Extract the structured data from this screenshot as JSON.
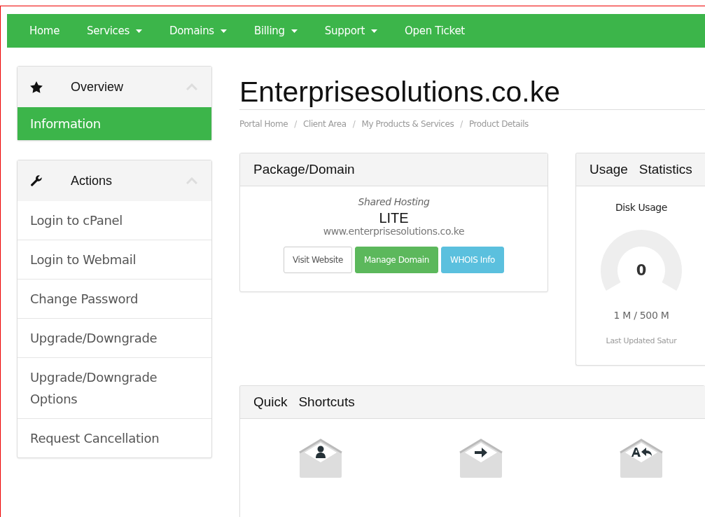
{
  "nav": {
    "items": [
      {
        "label": "Home",
        "dropdown": false
      },
      {
        "label": "Services",
        "dropdown": true
      },
      {
        "label": "Domains",
        "dropdown": true
      },
      {
        "label": "Billing",
        "dropdown": true
      },
      {
        "label": "Support",
        "dropdown": true
      },
      {
        "label": "Open Ticket",
        "dropdown": false
      }
    ]
  },
  "sidebar": {
    "panels": [
      {
        "title": "Overview",
        "items": [
          {
            "label": "Information",
            "selected": true
          }
        ]
      },
      {
        "title": "Actions",
        "items": [
          {
            "label": "Login to cPanel",
            "selected": false
          },
          {
            "label": "Login to Webmail",
            "selected": false
          },
          {
            "label": "Change Password",
            "selected": false
          },
          {
            "label": "Upgrade/Downgrade",
            "selected": false
          },
          {
            "label": "Upgrade/Downgrade Options",
            "selected": false
          },
          {
            "label": "Request Cancellation",
            "selected": false
          }
        ]
      }
    ]
  },
  "page": {
    "title": "Enterprisesolutions.co.ke",
    "breadcrumb": [
      {
        "label": "Portal Home"
      },
      {
        "separator": "/",
        "label": "Client Area"
      },
      {
        "separator": "/",
        "label": "My Products & Services"
      },
      {
        "separator": "/",
        "label": "Product Details"
      }
    ]
  },
  "package": {
    "title": "Package/Domain",
    "group": "Shared Hosting",
    "product": "LITE",
    "domain": "www.enterprisesolutions.co.ke",
    "buttons": [
      {
        "label": "Visit Website",
        "kind": "default"
      },
      {
        "label": "Manage Domain",
        "kind": "success"
      },
      {
        "label": "WHOIS Info",
        "kind": "info"
      }
    ]
  },
  "usage": {
    "title": "Usage   Statistics",
    "label": "Disk Usage",
    "value": "0",
    "reading": "1 M / 500 M",
    "updated": "Last Updated Satur"
  },
  "shortcuts": {
    "title": "Quick   Shortcuts",
    "items": [
      {
        "kind": "person"
      },
      {
        "kind": "forward"
      },
      {
        "kind": "reply"
      }
    ]
  }
}
